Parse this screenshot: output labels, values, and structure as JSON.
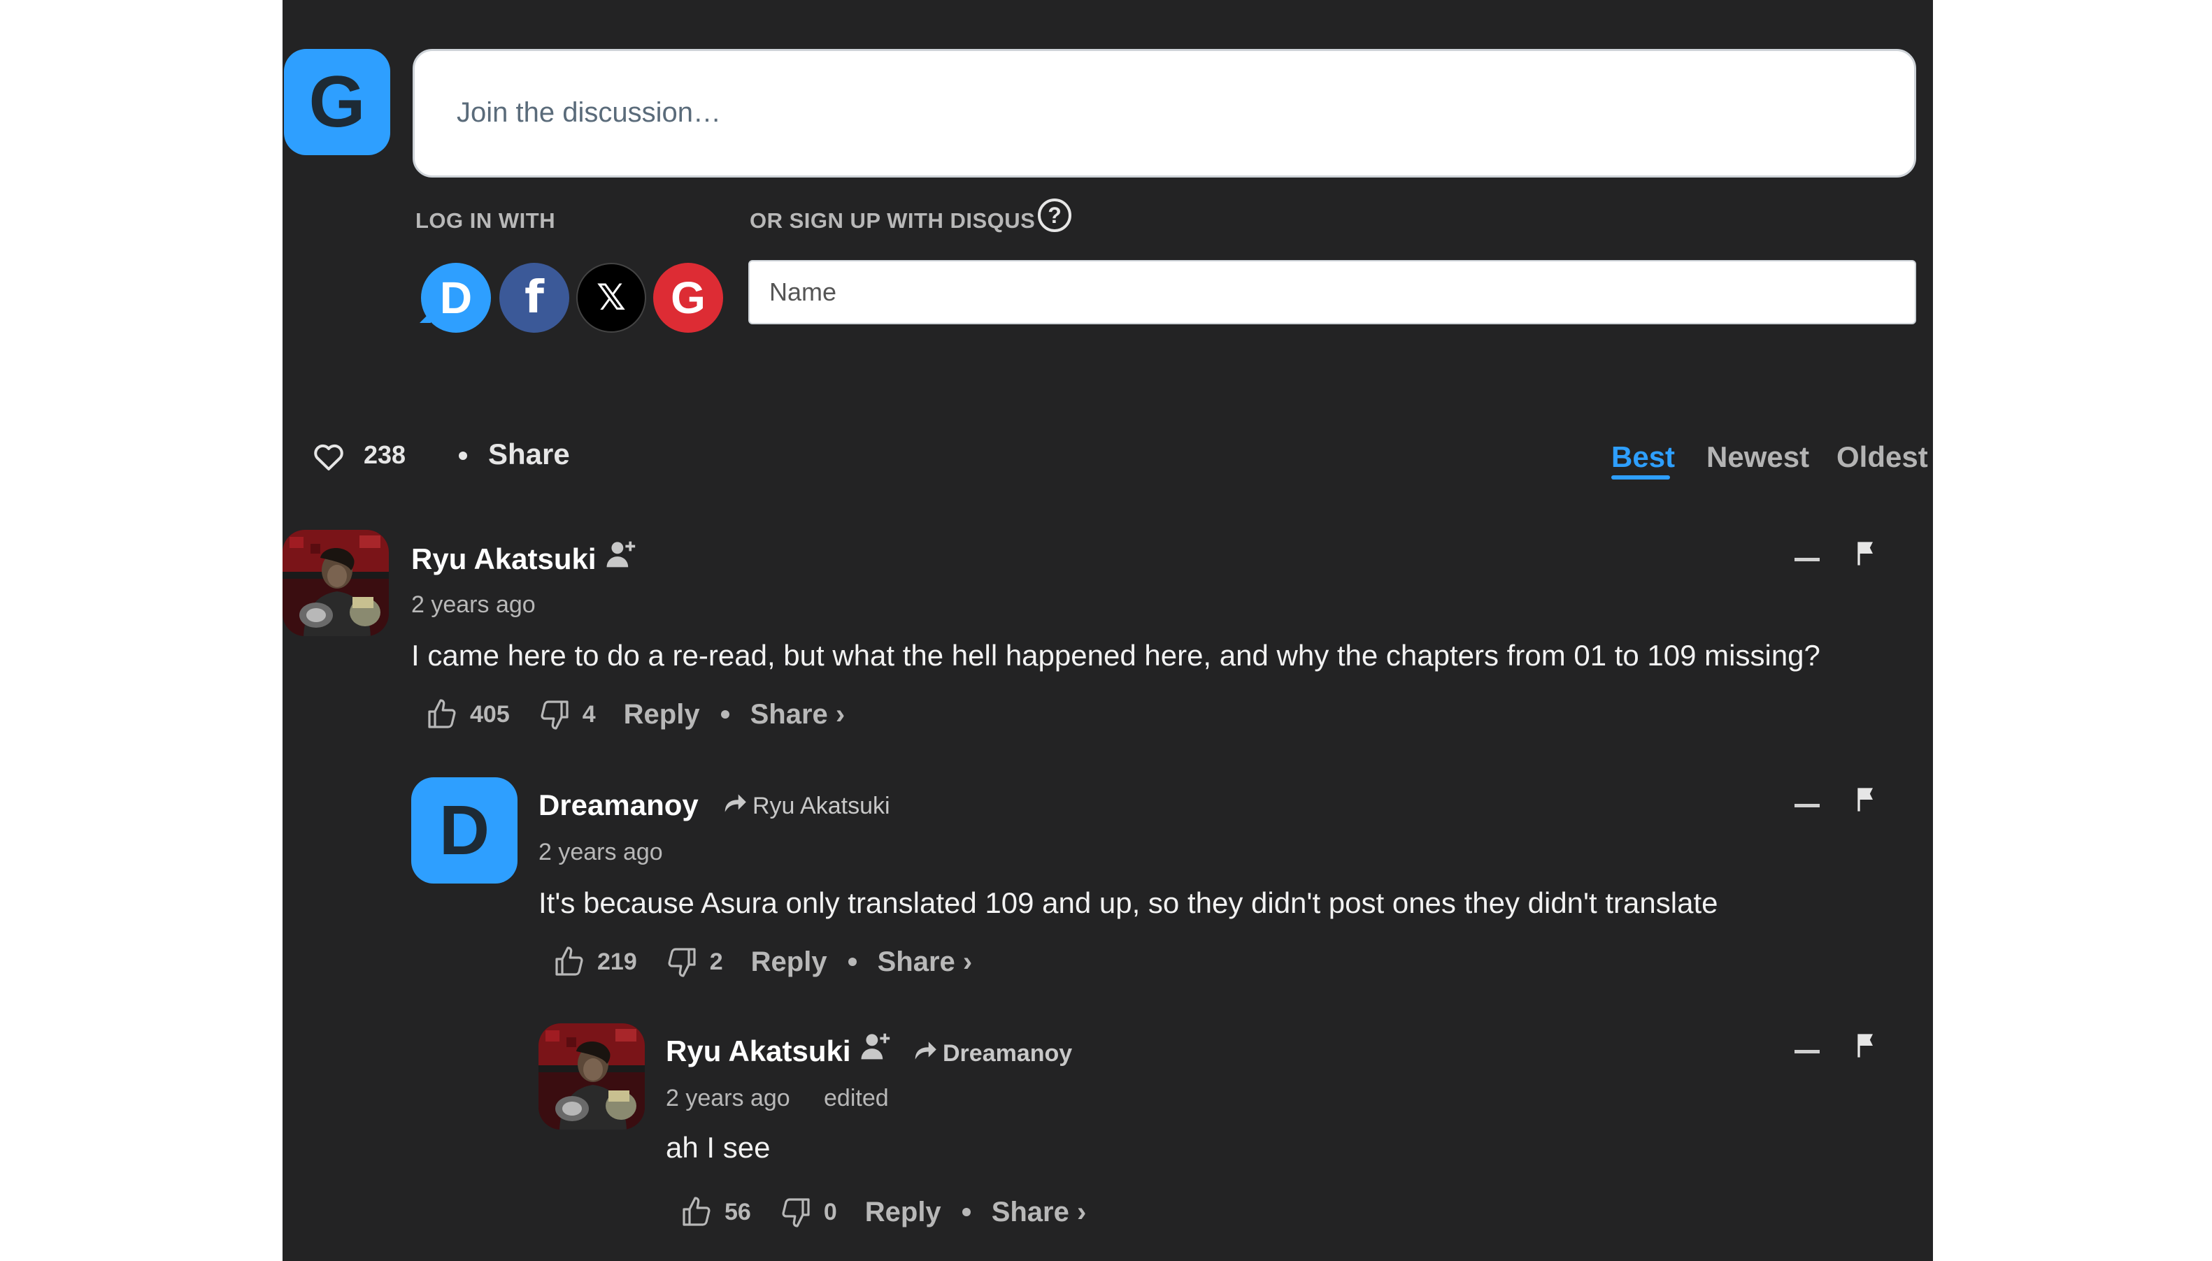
{
  "composer": {
    "avatar_letter": "G",
    "placeholder": "Join the discussion…",
    "login_label": "LOG IN WITH",
    "signup_label": "OR SIGN UP WITH DISQUS",
    "help_symbol": "?",
    "name_placeholder": "Name",
    "social": [
      {
        "name": "disqus",
        "glyph": "D",
        "color": "#2e9fff"
      },
      {
        "name": "facebook",
        "glyph": "f",
        "color": "#3b5998"
      },
      {
        "name": "x",
        "glyph": "𝕏",
        "color": "#000000"
      },
      {
        "name": "google",
        "glyph": "G",
        "color": "#dd2c34"
      }
    ]
  },
  "toolbar": {
    "like_count": "238",
    "share_label": "Share",
    "sort_tabs": [
      "Best",
      "Newest",
      "Oldest"
    ],
    "active_sort": "Best"
  },
  "colors": {
    "background": "#232324",
    "accent": "#2e9fff"
  },
  "comments": [
    {
      "author": "Ryu Akatsuki",
      "time": "2 years ago",
      "text": "I came here to do a re-read, but what the hell happened here, and why the chapters from 01 to 109 missing?",
      "upvotes": "405",
      "downvotes": "4",
      "reply_label": "Reply",
      "share_label": "Share ›"
    },
    {
      "author": "Dreamanoy",
      "avatar_letter": "D",
      "reply_to": "Ryu Akatsuki",
      "time": "2 years ago",
      "text": "It's because Asura only translated 109 and up, so they didn't post ones they didn't translate",
      "upvotes": "219",
      "downvotes": "2",
      "reply_label": "Reply",
      "share_label": "Share ›"
    },
    {
      "author": "Ryu Akatsuki",
      "reply_to": "Dreamanoy",
      "time": "2 years ago",
      "edited": "edited",
      "text": "ah I see",
      "upvotes": "56",
      "downvotes": "0",
      "reply_label": "Reply",
      "share_label": "Share ›"
    }
  ]
}
